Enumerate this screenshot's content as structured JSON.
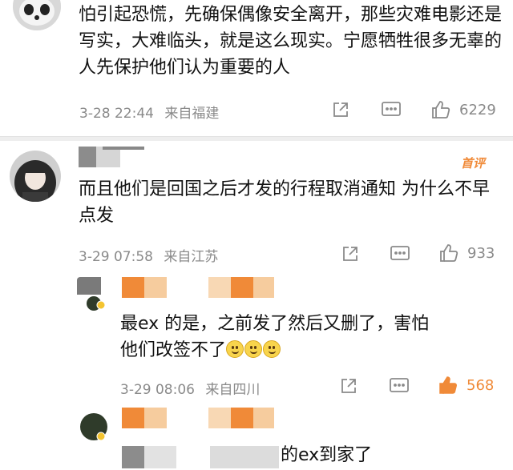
{
  "comments": [
    {
      "avatar": "panda-avatar",
      "text": "怕引起恐慌，先确保偶像安全离开，那些灾难电影还是写实，大难临头，就是这么现实。宁愿牺牲很多无辜的人先保护他们认为重要的人",
      "time": "3-28 22:44",
      "source": "来自福建",
      "likes": "6229",
      "liked": false
    },
    {
      "avatar": "girl-avatar",
      "badge": "首评",
      "text": "而且他们是回国之后才发的行程取消通知 为什么不早点发",
      "time": "3-29 07:58",
      "source": "来自江苏",
      "likes": "933",
      "liked": false
    },
    {
      "avatar": "user-avatar",
      "text": "最ex 的是，之前发了然后又删了，害怕他们改签不了",
      "time": "3-29 08:06",
      "source": "来自四川",
      "likes": "568",
      "liked": true
    },
    {
      "avatar": "user-avatar",
      "text": "的ex到家了"
    }
  ],
  "colors": {
    "liked": "#f08a38",
    "meta": "#8a8a8a",
    "badge": "#f08a38"
  },
  "icons": [
    "share-icon",
    "comment-icon",
    "like-icon"
  ]
}
